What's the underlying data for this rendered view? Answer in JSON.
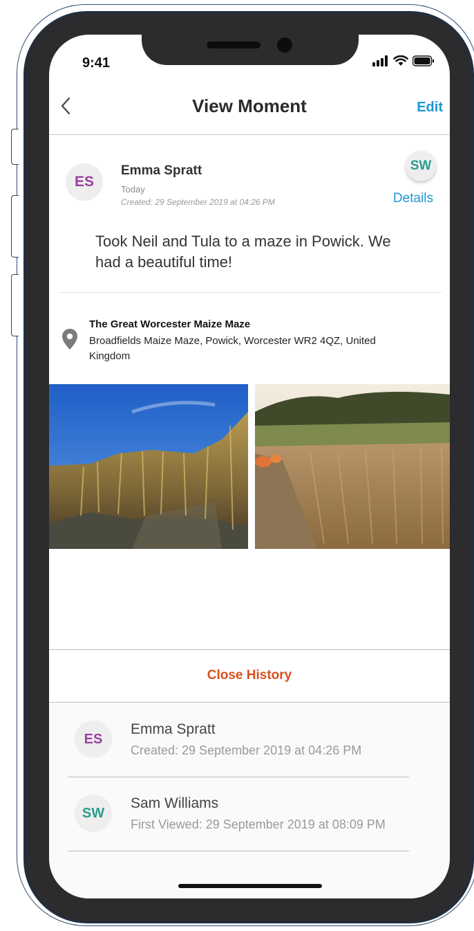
{
  "status_bar": {
    "time": "9:41"
  },
  "nav": {
    "title": "View Moment",
    "edit_label": "Edit"
  },
  "moment": {
    "author_initials": "ES",
    "author_name": "Emma Spratt",
    "day": "Today",
    "created": "Created: 29 September 2019 at 04:26 PM",
    "viewer_initials": "SW",
    "details_label": "Details",
    "text": "Took Neil and Tula to a maze in Powick. We had a beautiful time!",
    "location": {
      "name": "The Great Worcester Maize Maze",
      "address": "Broadfields Maize Maze, Powick, Worcester WR2 4QZ, United Kingdom"
    }
  },
  "history": {
    "toggle_label": "Close History",
    "entries": [
      {
        "initials": "ES",
        "name": "Emma Spratt",
        "detail": "Created: 29 September 2019 at 04:26 PM"
      },
      {
        "initials": "SW",
        "name": "Sam Williams",
        "detail": "First Viewed: 29 September 2019 at 08:09 PM"
      }
    ]
  },
  "colors": {
    "accent_blue": "#1f97d4",
    "accent_orange": "#d9501e",
    "avatar_es": "#9b3fa1",
    "avatar_sw": "#2a9d8f"
  },
  "icons": [
    "back-chevron-icon",
    "signal-icon",
    "wifi-icon",
    "battery-icon",
    "location-pin-icon"
  ]
}
